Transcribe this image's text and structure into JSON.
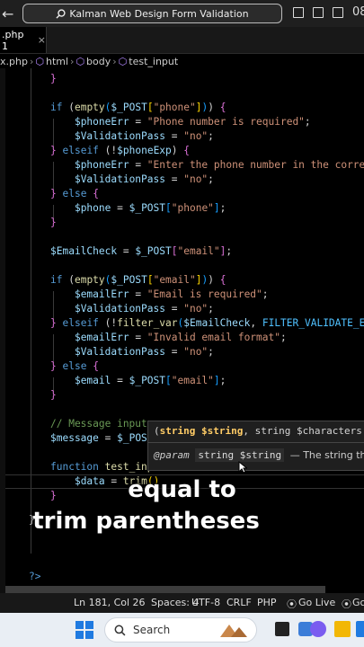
{
  "titlebar": {
    "back_arrow": "←",
    "forward_arrow": "→",
    "search_text": "Kalman Web Design Form Validation",
    "window_number": "08"
  },
  "tab": {
    "label": ".php 1",
    "close": "×"
  },
  "breadcrumb": {
    "file": "x.php",
    "items": [
      "html",
      "body",
      "test_input"
    ]
  },
  "code_lines": [
    [
      [
        "}",
        "bk2"
      ]
    ],
    [],
    [
      [
        "if",
        "kw"
      ],
      [
        " (",
        "txt"
      ],
      [
        "empty",
        "fn"
      ],
      [
        "(",
        "bk3"
      ],
      [
        "$_POST",
        "var"
      ],
      [
        "[",
        "bk1"
      ],
      [
        "\"phone\"",
        "str"
      ],
      [
        "]",
        "bk1"
      ],
      [
        ")",
        "bk3"
      ],
      [
        ")",
        "txt"
      ],
      [
        " ",
        "txt"
      ],
      [
        "{",
        "bk2"
      ]
    ],
    [
      [
        "    ",
        "txt"
      ],
      [
        "$phoneErr",
        "var"
      ],
      [
        " = ",
        "txt"
      ],
      [
        "\"Phone number is required\"",
        "str"
      ],
      [
        ";",
        "txt"
      ]
    ],
    [
      [
        "    ",
        "txt"
      ],
      [
        "$ValidationPass",
        "var"
      ],
      [
        " = ",
        "txt"
      ],
      [
        "\"no\"",
        "str"
      ],
      [
        ";",
        "txt"
      ]
    ],
    [
      [
        "}",
        "bk2"
      ],
      [
        " ",
        "txt"
      ],
      [
        "elseif",
        "kw"
      ],
      [
        " (",
        "txt"
      ],
      [
        "!",
        "txt"
      ],
      [
        "$phoneExp",
        "var"
      ],
      [
        ")",
        "txt"
      ],
      [
        " ",
        "txt"
      ],
      [
        "{",
        "bk2"
      ]
    ],
    [
      [
        "    ",
        "txt"
      ],
      [
        "$phoneErr",
        "var"
      ],
      [
        " = ",
        "txt"
      ],
      [
        "\"Enter the phone number in the correct",
        "str"
      ]
    ],
    [
      [
        "    ",
        "txt"
      ],
      [
        "$ValidationPass",
        "var"
      ],
      [
        " = ",
        "txt"
      ],
      [
        "\"no\"",
        "str"
      ],
      [
        ";",
        "txt"
      ]
    ],
    [
      [
        "}",
        "bk2"
      ],
      [
        " ",
        "txt"
      ],
      [
        "else",
        "kw"
      ],
      [
        " ",
        "txt"
      ],
      [
        "{",
        "bk2"
      ]
    ],
    [
      [
        "    ",
        "txt"
      ],
      [
        "$phone",
        "var"
      ],
      [
        " = ",
        "txt"
      ],
      [
        "$_POST",
        "var"
      ],
      [
        "[",
        "bk3"
      ],
      [
        "\"phone\"",
        "str"
      ],
      [
        "]",
        "bk3"
      ],
      [
        ";",
        "txt"
      ]
    ],
    [
      [
        "}",
        "bk2"
      ]
    ],
    [],
    [
      [
        "$EmailCheck",
        "var"
      ],
      [
        " = ",
        "txt"
      ],
      [
        "$_POST",
        "var"
      ],
      [
        "[",
        "bk2"
      ],
      [
        "\"email\"",
        "str"
      ],
      [
        "]",
        "bk2"
      ],
      [
        ";",
        "txt"
      ]
    ],
    [],
    [
      [
        "if",
        "kw"
      ],
      [
        " (",
        "txt"
      ],
      [
        "empty",
        "fn"
      ],
      [
        "(",
        "bk3"
      ],
      [
        "$_POST",
        "var"
      ],
      [
        "[",
        "bk1"
      ],
      [
        "\"email\"",
        "str"
      ],
      [
        "]",
        "bk1"
      ],
      [
        ")",
        "bk3"
      ],
      [
        ")",
        "txt"
      ],
      [
        " ",
        "txt"
      ],
      [
        "{",
        "bk2"
      ]
    ],
    [
      [
        "    ",
        "txt"
      ],
      [
        "$emailErr",
        "var"
      ],
      [
        " = ",
        "txt"
      ],
      [
        "\"Email is required\"",
        "str"
      ],
      [
        ";",
        "txt"
      ]
    ],
    [
      [
        "    ",
        "txt"
      ],
      [
        "$ValidationPass",
        "var"
      ],
      [
        " = ",
        "txt"
      ],
      [
        "\"no\"",
        "str"
      ],
      [
        ";",
        "txt"
      ]
    ],
    [
      [
        "}",
        "bk2"
      ],
      [
        " ",
        "txt"
      ],
      [
        "elseif",
        "kw"
      ],
      [
        " (",
        "txt"
      ],
      [
        "!",
        "txt"
      ],
      [
        "filter_var",
        "fn"
      ],
      [
        "(",
        "bk3"
      ],
      [
        "$EmailCheck",
        "var"
      ],
      [
        ", ",
        "txt"
      ],
      [
        "FILTER_VALIDATE_EMA",
        "const"
      ]
    ],
    [
      [
        "    ",
        "txt"
      ],
      [
        "$emailErr",
        "var"
      ],
      [
        " = ",
        "txt"
      ],
      [
        "\"Invalid email format\"",
        "str"
      ],
      [
        ";",
        "txt"
      ]
    ],
    [
      [
        "    ",
        "txt"
      ],
      [
        "$ValidationPass",
        "var"
      ],
      [
        " = ",
        "txt"
      ],
      [
        "\"no\"",
        "str"
      ],
      [
        ";",
        "txt"
      ]
    ],
    [
      [
        "}",
        "bk2"
      ],
      [
        " ",
        "txt"
      ],
      [
        "else",
        "kw"
      ],
      [
        " ",
        "txt"
      ],
      [
        "{",
        "bk2"
      ]
    ],
    [
      [
        "    ",
        "txt"
      ],
      [
        "$email",
        "var"
      ],
      [
        " = ",
        "txt"
      ],
      [
        "$_POST",
        "var"
      ],
      [
        "[",
        "bk3"
      ],
      [
        "\"email\"",
        "str"
      ],
      [
        "]",
        "bk3"
      ],
      [
        ";",
        "txt"
      ]
    ],
    [
      [
        "}",
        "bk2"
      ]
    ],
    [],
    [
      [
        "// Message input",
        "com"
      ]
    ],
    [
      [
        "$message",
        "var"
      ],
      [
        " = ",
        "txt"
      ],
      [
        "$_POST",
        "var"
      ]
    ],
    [],
    [
      [
        "function",
        "kw"
      ],
      [
        " ",
        "txt"
      ],
      [
        "test_inp",
        "fn"
      ]
    ],
    [
      [
        "    ",
        "txt"
      ],
      [
        "$data",
        "var"
      ],
      [
        " = ",
        "txt"
      ],
      [
        "trim",
        "fn"
      ],
      [
        "(",
        "bk1"
      ],
      [
        ")",
        "bk1"
      ]
    ],
    [
      [
        "}",
        "bk2"
      ]
    ]
  ],
  "outer_lines": {
    "close_brace": "}",
    "php_close": "?>"
  },
  "signature_popup": {
    "open": "(",
    "param1_type": "string",
    "param1_name": "$string",
    "sep": ",",
    "param2_type": "string",
    "param2_name": "$characters",
    "tail": " =",
    "param_tag": "@param",
    "param_pill": "string $string",
    "param_desc": "— The string tha"
  },
  "caption": {
    "line1": "equal to",
    "line2": "trim parentheses"
  },
  "statusbar": {
    "position": "Ln 181, Col 26",
    "spaces": "Spaces: 4",
    "encoding": "UTF-8",
    "eol": "CRLF",
    "language": "PHP",
    "go_live": "Go Live",
    "extra": "Gc"
  },
  "taskbar": {
    "search_placeholder": "Search"
  },
  "colors": {
    "keyword": "#569cd6",
    "function": "#dcdcaa",
    "variable": "#9cdcfe",
    "string": "#ce9178",
    "comment": "#6a9955"
  }
}
